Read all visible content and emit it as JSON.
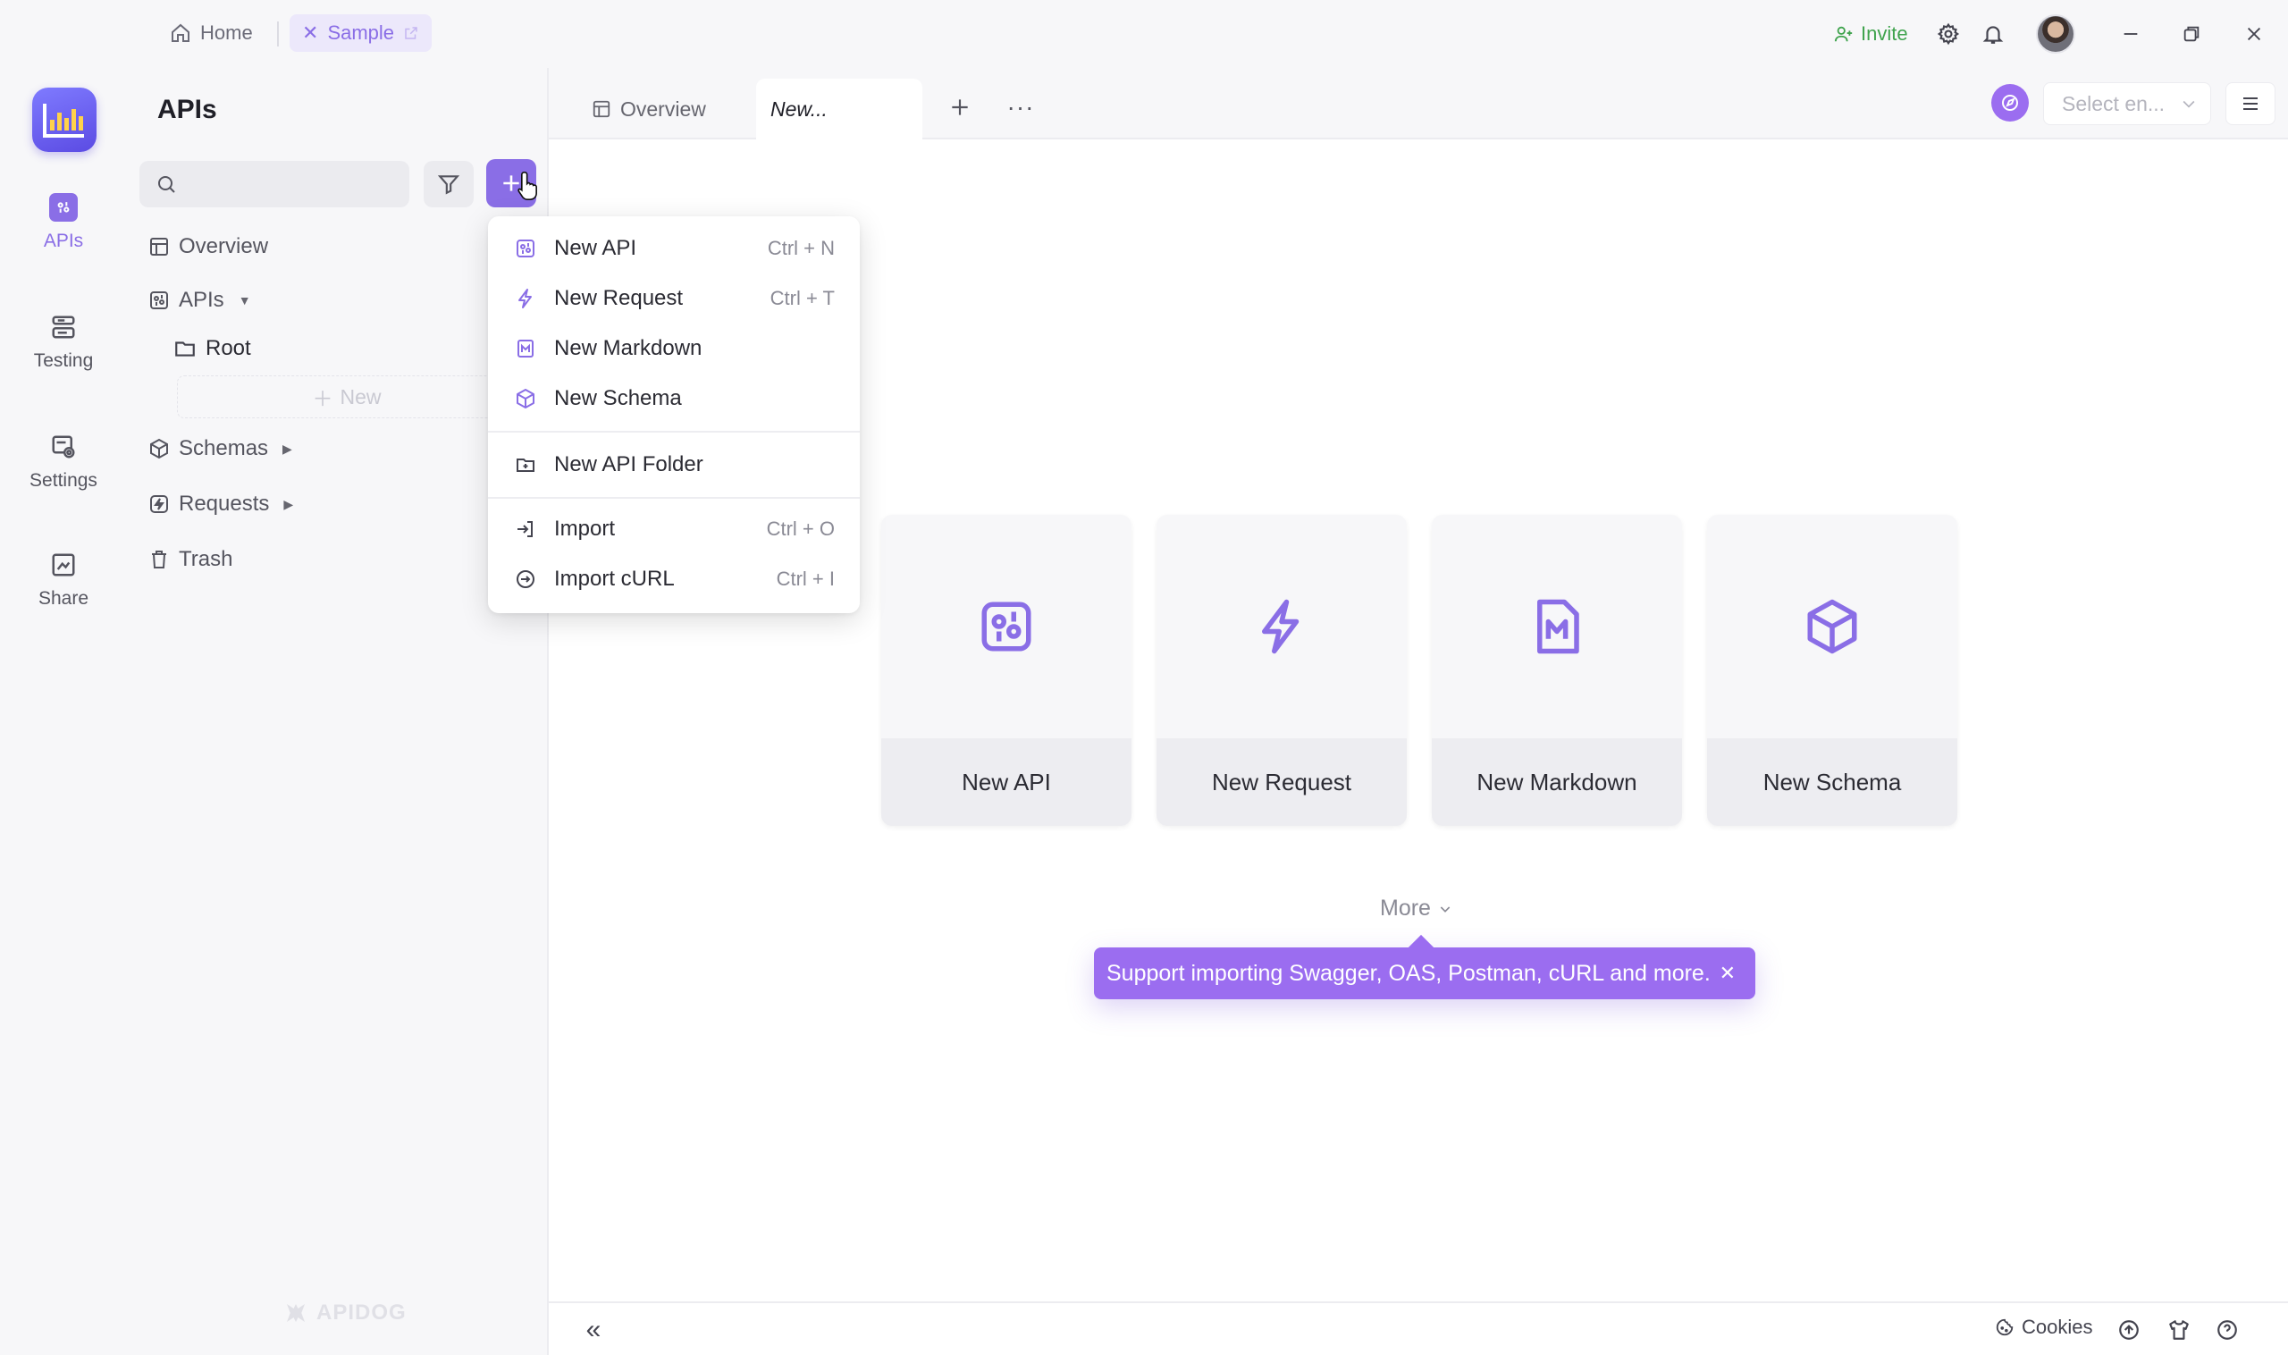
{
  "titlebar": {
    "home_label": "Home",
    "sample_label": "Sample",
    "invite_label": "Invite"
  },
  "rail": {
    "items": [
      {
        "label": "APIs",
        "icon": "api-icon",
        "active": true
      },
      {
        "label": "Testing",
        "icon": "testing-icon",
        "active": false
      },
      {
        "label": "Settings",
        "icon": "settings-icon",
        "active": false
      },
      {
        "label": "Share",
        "icon": "share-icon",
        "active": false
      }
    ]
  },
  "sidebar": {
    "title": "APIs",
    "search_placeholder": "",
    "tree": {
      "overview": "Overview",
      "apis": "APIs",
      "root": "Root",
      "new": "New",
      "schemas": "Schemas",
      "requests": "Requests",
      "trash": "Trash"
    },
    "watermark": "APIDOG"
  },
  "tabs": {
    "overview": "Overview",
    "active": "New..."
  },
  "env": {
    "placeholder": "Select en..."
  },
  "cards": [
    {
      "label": "New API",
      "icon": "api-icon"
    },
    {
      "label": "New Request",
      "icon": "lightning-icon"
    },
    {
      "label": "New Markdown",
      "icon": "markdown-icon"
    },
    {
      "label": "New Schema",
      "icon": "cube-icon"
    }
  ],
  "more_label": "More",
  "tip_text": "Support importing Swagger, OAS, Postman, cURL and more.",
  "footer": {
    "cookies_label": "Cookies"
  },
  "dropdown": {
    "items": [
      {
        "label": "New API",
        "shortcut": "Ctrl + N",
        "icon": "api-icon"
      },
      {
        "label": "New Request",
        "shortcut": "Ctrl + T",
        "icon": "lightning-icon"
      },
      {
        "label": "New Markdown",
        "shortcut": "",
        "icon": "markdown-icon"
      },
      {
        "label": "New Schema",
        "shortcut": "",
        "icon": "cube-icon"
      },
      {
        "label": "New API Folder",
        "shortcut": "",
        "icon": "folder-plus-icon"
      },
      {
        "label": "Import",
        "shortcut": "Ctrl + O",
        "icon": "import-icon"
      },
      {
        "label": "Import cURL",
        "shortcut": "Ctrl + I",
        "icon": "import-curl-icon"
      }
    ]
  },
  "colors": {
    "accent": "#8a6ee6",
    "invite": "#3fa34d",
    "tip": "#9b6df0"
  }
}
